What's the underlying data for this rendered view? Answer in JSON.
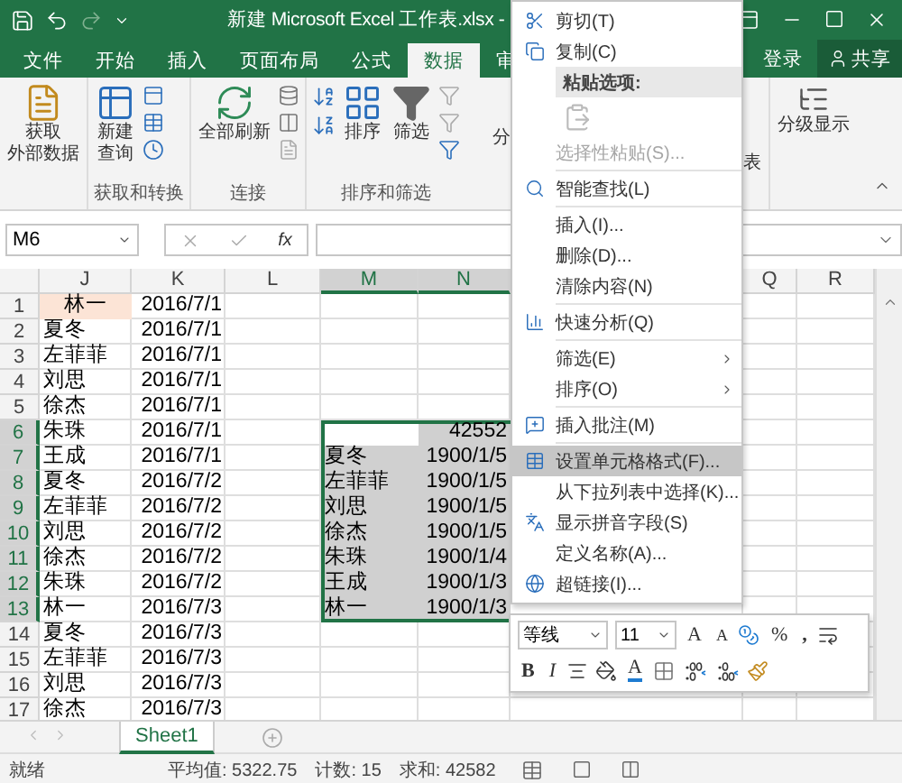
{
  "title_bar": {
    "title": "新建 Microsoft Excel 工作表.xlsx -"
  },
  "tabs": [
    {
      "label": "文件",
      "selected": false
    },
    {
      "label": "开始",
      "selected": false
    },
    {
      "label": "插入",
      "selected": false
    },
    {
      "label": "页面布局",
      "selected": false
    },
    {
      "label": "公式",
      "selected": false
    },
    {
      "label": "数据",
      "selected": true
    },
    {
      "label": "审",
      "selected": false
    }
  ],
  "account": {
    "sign_in": "登录",
    "share": "共享"
  },
  "ribbon": {
    "groups": [
      {
        "kind": "external",
        "buttons": [
          [
            "获取",
            "外部数据"
          ]
        ]
      },
      {
        "kind": "query",
        "label": "获取和转换",
        "buttons": [
          [
            "新建",
            "查询"
          ]
        ]
      },
      {
        "kind": "connections",
        "label": "连接",
        "buttons": [
          "全部刷新"
        ]
      },
      {
        "kind": "sort",
        "label": "排序和筛选",
        "buttons": [
          "排序",
          "筛选"
        ]
      }
    ],
    "left_fragment": "分",
    "right_fragment": "表",
    "outline_button": "分级显示"
  },
  "formula_bar": {
    "name_box": "M6",
    "fx": "fx"
  },
  "sheet": {
    "columns": [
      {
        "label": "J",
        "selected": false
      },
      {
        "label": "K",
        "selected": false
      },
      {
        "label": "L",
        "selected": false
      },
      {
        "label": "M",
        "selected": true
      },
      {
        "label": "N",
        "selected": true
      },
      {
        "label": "Q",
        "selected": false
      },
      {
        "label": "R",
        "selected": false
      }
    ],
    "rows": [
      {
        "header": "1",
        "selected": false,
        "cells": [
          {
            "text": "林一",
            "highlighted": true,
            "selected": false
          },
          {
            "text": "2016/7/1",
            "selected": false
          },
          {
            "selected": false
          },
          {
            "selected": false
          },
          {
            "selected": false
          }
        ]
      },
      {
        "header": "2",
        "selected": false,
        "cells": [
          {
            "text": "夏冬",
            "selected": false
          },
          {
            "text": "2016/7/1",
            "selected": false
          },
          {
            "selected": false
          },
          {
            "selected": false
          },
          {
            "selected": false
          }
        ]
      },
      {
        "header": "3",
        "selected": false,
        "cells": [
          {
            "text": "左菲菲",
            "selected": false
          },
          {
            "text": "2016/7/1",
            "selected": false
          },
          {
            "selected": false
          },
          {
            "selected": false
          },
          {
            "selected": false
          }
        ]
      },
      {
        "header": "4",
        "selected": false,
        "cells": [
          {
            "text": "刘思",
            "selected": false
          },
          {
            "text": "2016/7/1",
            "selected": false
          },
          {
            "selected": false
          },
          {
            "selected": false
          },
          {
            "selected": false
          }
        ]
      },
      {
        "header": "5",
        "selected": false,
        "cells": [
          {
            "text": "徐杰",
            "selected": false
          },
          {
            "text": "2016/7/1",
            "selected": false
          },
          {
            "selected": false
          },
          {
            "selected": false
          },
          {
            "selected": false
          }
        ]
      },
      {
        "header": "6",
        "selected": true,
        "cells": [
          {
            "text": "朱珠",
            "selected": false
          },
          {
            "text": "2016/7/1",
            "selected": false
          },
          {
            "selected": false
          },
          {
            "selected": true,
            "active": true
          },
          {
            "text": "42552",
            "selected": true
          }
        ]
      },
      {
        "header": "7",
        "selected": true,
        "cells": [
          {
            "text": "王成",
            "selected": false
          },
          {
            "text": "2016/7/1",
            "selected": false
          },
          {
            "selected": false
          },
          {
            "text": "夏冬",
            "selected": true
          },
          {
            "text": "1900/1/5",
            "selected": true
          }
        ]
      },
      {
        "header": "8",
        "selected": true,
        "cells": [
          {
            "text": "夏冬",
            "selected": false
          },
          {
            "text": "2016/7/2",
            "selected": false
          },
          {
            "selected": false
          },
          {
            "text": "左菲菲",
            "selected": true
          },
          {
            "text": "1900/1/5",
            "selected": true
          }
        ]
      },
      {
        "header": "9",
        "selected": true,
        "cells": [
          {
            "text": "左菲菲",
            "selected": false
          },
          {
            "text": "2016/7/2",
            "selected": false
          },
          {
            "selected": false
          },
          {
            "text": "刘思",
            "selected": true
          },
          {
            "text": "1900/1/5",
            "selected": true
          }
        ]
      },
      {
        "header": "10",
        "selected": true,
        "cells": [
          {
            "text": "刘思",
            "selected": false
          },
          {
            "text": "2016/7/2",
            "selected": false
          },
          {
            "selected": false
          },
          {
            "text": "徐杰",
            "selected": true
          },
          {
            "text": "1900/1/5",
            "selected": true
          }
        ]
      },
      {
        "header": "11",
        "selected": true,
        "cells": [
          {
            "text": "徐杰",
            "selected": false
          },
          {
            "text": "2016/7/2",
            "selected": false
          },
          {
            "selected": false
          },
          {
            "text": "朱珠",
            "selected": true
          },
          {
            "text": "1900/1/4",
            "selected": true
          }
        ]
      },
      {
        "header": "12",
        "selected": true,
        "cells": [
          {
            "text": "朱珠",
            "selected": false
          },
          {
            "text": "2016/7/2",
            "selected": false
          },
          {
            "selected": false
          },
          {
            "text": "王成",
            "selected": true
          },
          {
            "text": "1900/1/3",
            "selected": true
          }
        ]
      },
      {
        "header": "13",
        "selected": true,
        "cells": [
          {
            "text": "林一",
            "selected": false
          },
          {
            "text": "2016/7/3",
            "selected": false
          },
          {
            "selected": false
          },
          {
            "text": "林一",
            "selected": true
          },
          {
            "text": "1900/1/3",
            "selected": true
          }
        ]
      },
      {
        "header": "14",
        "selected": false,
        "cells": [
          {
            "text": "夏冬",
            "selected": false
          },
          {
            "text": "2016/7/3",
            "selected": false
          },
          {
            "selected": false
          },
          {
            "selected": false
          },
          {
            "selected": false
          }
        ]
      },
      {
        "header": "15",
        "selected": false,
        "cells": [
          {
            "text": "左菲菲",
            "selected": false
          },
          {
            "text": "2016/7/3",
            "selected": false
          },
          {
            "selected": false
          },
          {
            "selected": false
          },
          {
            "selected": false
          }
        ]
      },
      {
        "header": "16",
        "selected": false,
        "cells": [
          {
            "text": "刘思",
            "selected": false
          },
          {
            "text": "2016/7/3",
            "selected": false
          },
          {
            "selected": false
          },
          {
            "selected": false
          },
          {
            "selected": false
          }
        ]
      },
      {
        "header": "17",
        "selected": false,
        "cells": [
          {
            "text": "徐杰",
            "selected": false
          },
          {
            "text": "2016/7/3",
            "selected": false
          },
          {
            "selected": false
          },
          {
            "selected": false
          },
          {
            "selected": false
          }
        ]
      }
    ]
  },
  "sheet_tabs": [
    {
      "label": "Sheet1",
      "selected": true
    }
  ],
  "status_bar": {
    "state": "就绪",
    "average": "平均值: 5322.75",
    "count": "计数: 15",
    "sum": "求和: 42582"
  },
  "context_menu": [
    {
      "kind": "item",
      "label": "剪切(T)",
      "disabled": false,
      "selected": false,
      "submenu": false
    },
    {
      "kind": "item",
      "label": "复制(C)",
      "disabled": false,
      "selected": false,
      "submenu": false
    },
    {
      "kind": "header",
      "label": "粘贴选项:"
    },
    {
      "kind": "paste_options"
    },
    {
      "kind": "item",
      "label": "选择性粘贴(S)...",
      "disabled": true,
      "selected": false,
      "submenu": false
    },
    {
      "kind": "separator"
    },
    {
      "kind": "item",
      "label": "智能查找(L)",
      "disabled": false,
      "selected": false,
      "submenu": false
    },
    {
      "kind": "separator"
    },
    {
      "kind": "item",
      "label": "插入(I)...",
      "disabled": false,
      "selected": false,
      "submenu": false
    },
    {
      "kind": "item",
      "label": "删除(D)...",
      "disabled": false,
      "selected": false,
      "submenu": false
    },
    {
      "kind": "item",
      "label": "清除内容(N)",
      "disabled": false,
      "selected": false,
      "submenu": false
    },
    {
      "kind": "separator"
    },
    {
      "kind": "item",
      "label": "快速分析(Q)",
      "disabled": false,
      "selected": false,
      "submenu": false
    },
    {
      "kind": "separator"
    },
    {
      "kind": "item",
      "label": "筛选(E)",
      "disabled": false,
      "selected": false,
      "submenu": true
    },
    {
      "kind": "item",
      "label": "排序(O)",
      "disabled": false,
      "selected": false,
      "submenu": true
    },
    {
      "kind": "separator"
    },
    {
      "kind": "item",
      "label": "插入批注(M)",
      "disabled": false,
      "selected": false,
      "submenu": false
    },
    {
      "kind": "separator"
    },
    {
      "kind": "item",
      "label": "设置单元格格式(F)...",
      "disabled": false,
      "selected": true,
      "submenu": false
    },
    {
      "kind": "item",
      "label": "从下拉列表中选择(K)...",
      "disabled": false,
      "selected": false,
      "submenu": false
    },
    {
      "kind": "item",
      "label": "显示拼音字段(S)",
      "disabled": false,
      "selected": false,
      "submenu": false
    },
    {
      "kind": "item",
      "label": "定义名称(A)...",
      "disabled": false,
      "selected": false,
      "submenu": false
    },
    {
      "kind": "item",
      "label": "超链接(I)...",
      "disabled": false,
      "selected": false,
      "submenu": false
    }
  ],
  "mini_toolbar": {
    "top_row": [
      {
        "kind": "font",
        "text": "等线"
      },
      {
        "kind": "size",
        "text": "11"
      },
      {
        "kind": "grow",
        "text": "A"
      },
      {
        "kind": "shrink",
        "text": "A"
      },
      {
        "kind": "accounting"
      },
      {
        "kind": "percent",
        "text": "%"
      },
      {
        "kind": "comma",
        "text": ","
      },
      {
        "kind": "wrap"
      }
    ],
    "bottom_row": [
      {
        "kind": "bold",
        "text": "B"
      },
      {
        "kind": "italic",
        "text": "I"
      },
      {
        "kind": "align"
      },
      {
        "kind": "fill"
      },
      {
        "kind": "font_color",
        "text": "A"
      },
      {
        "kind": "border"
      },
      {
        "kind": "inc_decimal"
      },
      {
        "kind": "dec_decimal"
      },
      {
        "kind": "painter"
      }
    ]
  }
}
